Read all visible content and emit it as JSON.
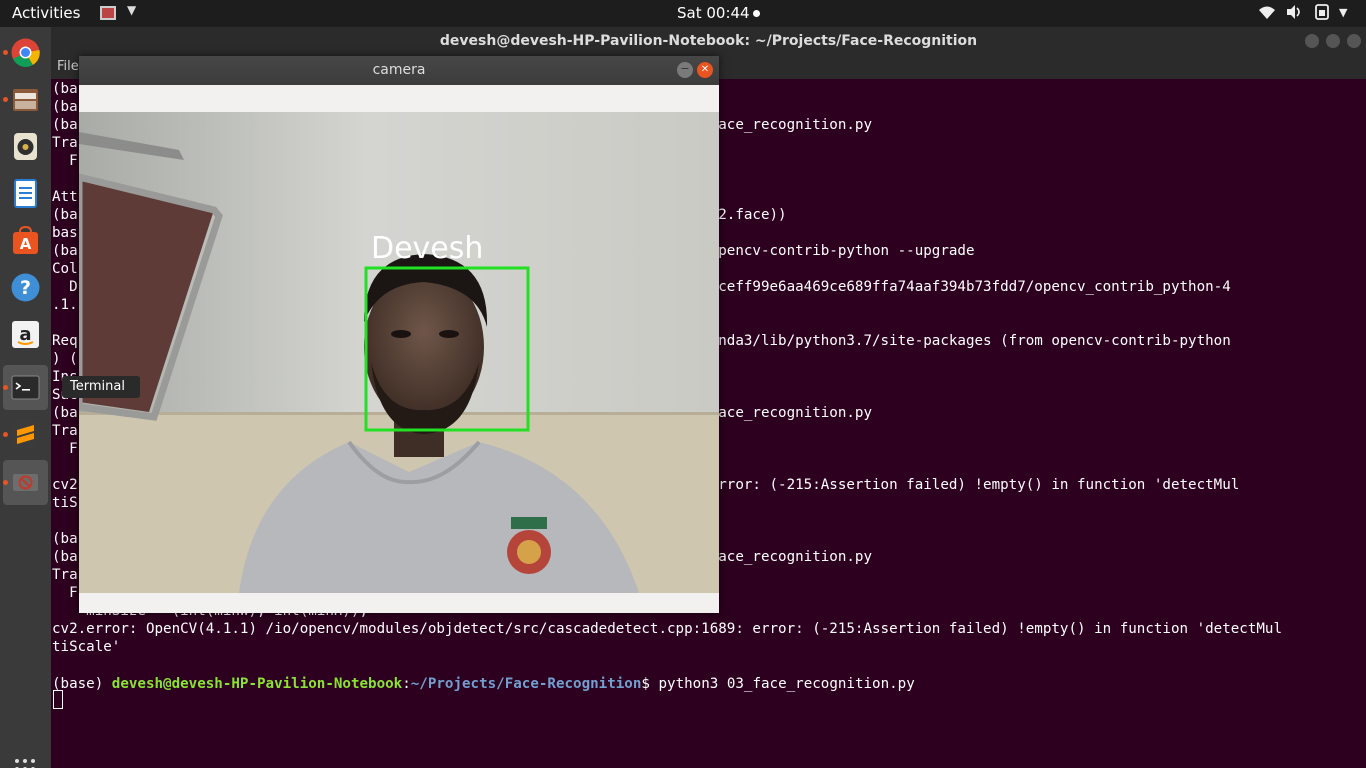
{
  "topbar": {
    "activities": "Activities",
    "clock": "Sat 00:44"
  },
  "launcher": {
    "items": [
      {
        "name": "chrome-icon",
        "color": "#db4437"
      },
      {
        "name": "files-icon",
        "color": "#b86b3c"
      },
      {
        "name": "rhythmbox-icon",
        "color": "#d8b14a"
      },
      {
        "name": "writer-icon",
        "color": "#2a7fd4"
      },
      {
        "name": "software-center-icon",
        "color": "#e95420"
      },
      {
        "name": "help-icon",
        "color": "#3f8fd6"
      },
      {
        "name": "amazon-icon",
        "color": "#f2f2f2"
      },
      {
        "name": "terminal-icon",
        "color": "#222222"
      },
      {
        "name": "sublime-icon",
        "color": "#ff9800"
      },
      {
        "name": "camera-app-icon",
        "color": "#c0392b"
      }
    ],
    "tooltip": "Terminal"
  },
  "terminal": {
    "title": "devesh@devesh-HP-Pavilion-Notebook: ~/Projects/Face-Recognition",
    "menu_file": "File",
    "lines": [
      "(ba",
      "(ba",
      "(ba                                                                 thon3 03_face_recognition.py",
      "Tra",
      "  F",
      "",
      "Att",
      "(ba                                                                 nt(dir (cv2.face))",
      "bas",
      "(ba                                                                  install opencv-contrib-python --upgrade",
      "Col",
      "  D                                                                 0cf828f7d3ceff99e6aa469ce689ffa74aaf394b73fdd7/opencv_contrib_python-4",
      ".1.",
      "",
      "Req                                                                 vesh/anaconda3/lib/python3.7/site-packages (from opencv-contrib-python",
      ") (",
      "Ins",
      "Suc",
      "(ba                                                                 thon3 03_face_recognition.py",
      "Tra",
      "  F",
      "",
      "cv2                                                                 pp:1689: error: (-215:Assertion failed) !empty() in function 'detectMul",
      "tiS",
      "",
      "(ba",
      "(ba                                                                 thon3 03_face_recognition.py",
      "Tra",
      "  F",
      "    minSize = (int(minW), int(minH)),",
      "cv2.error: OpenCV(4.1.1) /io/opencv/modules/objdetect/src/cascadedetect.cpp:1689: error: (-215:Assertion failed) !empty() in function 'detectMul",
      "tiScale'"
    ],
    "prompt": {
      "env": "(base) ",
      "user_host": "devesh@devesh-HP-Pavilion-Notebook",
      "sep": ":",
      "path": "~/Projects/Face-Recognition",
      "dollar": "$ ",
      "command": "python3 03_face_recognition.py"
    }
  },
  "camera": {
    "title": "camera",
    "min_glyph": "−",
    "close_glyph": "✕",
    "face_label": "Devesh"
  }
}
